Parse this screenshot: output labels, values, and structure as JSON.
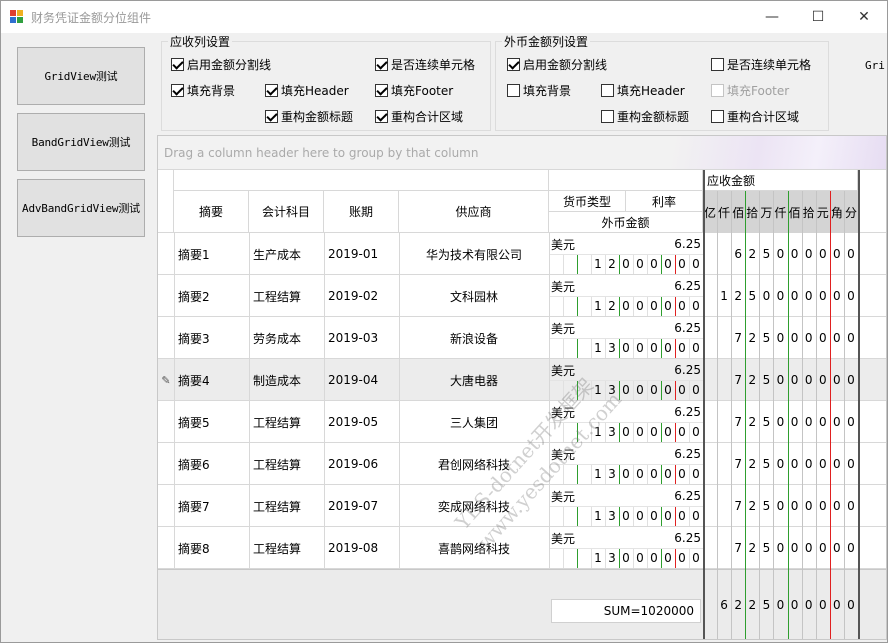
{
  "window": {
    "title": "财务凭证金额分位组件",
    "minimize": "—",
    "maximize": "☐",
    "close": "✕"
  },
  "sidebar": {
    "buttons": [
      "GridView测试",
      "BandGridView测试",
      "AdvBandGridView测试"
    ]
  },
  "group_receivable": {
    "title": "应收列设置",
    "options": [
      {
        "label": "启用金额分割线",
        "checked": true,
        "enabled": true
      },
      {
        "label": "是否连续单元格",
        "checked": true,
        "enabled": true
      },
      {
        "label": "填充背景",
        "checked": true,
        "enabled": true
      },
      {
        "label": "填充Header",
        "checked": true,
        "enabled": true
      },
      {
        "label": "填充Footer",
        "checked": true,
        "enabled": true
      },
      {
        "label": "重构金额标题",
        "checked": true,
        "enabled": true
      },
      {
        "label": "重构合计区域",
        "checked": true,
        "enabled": true
      }
    ]
  },
  "group_foreign": {
    "title": "外币金额列设置",
    "options": [
      {
        "label": "启用金额分割线",
        "checked": true,
        "enabled": true
      },
      {
        "label": "是否连续单元格",
        "checked": false,
        "enabled": true
      },
      {
        "label": "填充背景",
        "checked": false,
        "enabled": true
      },
      {
        "label": "填充Header",
        "checked": false,
        "enabled": true
      },
      {
        "label": "填充Footer",
        "checked": false,
        "enabled": false
      },
      {
        "label": "重构金额标题",
        "checked": false,
        "enabled": true
      },
      {
        "label": "重构合计区域",
        "checked": false,
        "enabled": true
      }
    ]
  },
  "cut_label": "Gri",
  "grid": {
    "group_panel_text": "Drag a column header here to group by that column",
    "headers": {
      "summary": "摘要",
      "account": "会计科目",
      "period": "账期",
      "supplier": "供应商",
      "currency_type": "货币类型",
      "rate": "利率",
      "foreign_amount": "外币金额",
      "receivable_amount": "应收金额",
      "digit_units": [
        "亿",
        "仟",
        "佰",
        "拾",
        "万",
        "仟",
        "佰",
        "拾",
        "元",
        "角",
        "分"
      ]
    },
    "rows": [
      {
        "summary": "摘要1",
        "account": "生产成本",
        "period": "2019-01",
        "supplier": "华为技术有限公司",
        "currency": "美元",
        "rate": "6.25",
        "foreign_digits": [
          "",
          "",
          "",
          "1",
          "2",
          "0",
          "0",
          "0",
          "0",
          "0",
          "0"
        ],
        "amount_digits": [
          "",
          "",
          "6",
          "2",
          "5",
          "0",
          "0",
          "0",
          "0",
          "0",
          "0"
        ]
      },
      {
        "summary": "摘要2",
        "account": "工程结算",
        "period": "2019-02",
        "supplier": "文科园林",
        "currency": "美元",
        "rate": "6.25",
        "foreign_digits": [
          "",
          "",
          "",
          "1",
          "2",
          "0",
          "0",
          "0",
          "0",
          "0",
          "0"
        ],
        "amount_digits": [
          "",
          "1",
          "2",
          "5",
          "0",
          "0",
          "0",
          "0",
          "0",
          "0",
          "0"
        ]
      },
      {
        "summary": "摘要3",
        "account": "劳务成本",
        "period": "2019-03",
        "supplier": "新浪设备",
        "currency": "美元",
        "rate": "6.25",
        "foreign_digits": [
          "",
          "",
          "",
          "1",
          "3",
          "0",
          "0",
          "0",
          "0",
          "0",
          "0"
        ],
        "amount_digits": [
          "",
          "",
          "7",
          "2",
          "5",
          "0",
          "0",
          "0",
          "0",
          "0",
          "0"
        ]
      },
      {
        "summary": "摘要4",
        "account": "制造成本",
        "period": "2019-04",
        "supplier": "大唐电器",
        "currency": "美元",
        "rate": "6.25",
        "foreign_digits": [
          "",
          "",
          "",
          "1",
          "3",
          "0",
          "0",
          "0",
          "0",
          "0",
          "0"
        ],
        "amount_digits": [
          "",
          "",
          "7",
          "2",
          "5",
          "0",
          "0",
          "0",
          "0",
          "0",
          "0"
        ],
        "focused": true
      },
      {
        "summary": "摘要5",
        "account": "工程结算",
        "period": "2019-05",
        "supplier": "三人集团",
        "currency": "美元",
        "rate": "6.25",
        "foreign_digits": [
          "",
          "",
          "",
          "1",
          "3",
          "0",
          "0",
          "0",
          "0",
          "0",
          "0"
        ],
        "amount_digits": [
          "",
          "",
          "7",
          "2",
          "5",
          "0",
          "0",
          "0",
          "0",
          "0",
          "0"
        ]
      },
      {
        "summary": "摘要6",
        "account": "工程结算",
        "period": "2019-06",
        "supplier": "君创网络科技",
        "currency": "美元",
        "rate": "6.25",
        "foreign_digits": [
          "",
          "",
          "",
          "1",
          "3",
          "0",
          "0",
          "0",
          "0",
          "0",
          "0"
        ],
        "amount_digits": [
          "",
          "",
          "7",
          "2",
          "5",
          "0",
          "0",
          "0",
          "0",
          "0",
          "0"
        ]
      },
      {
        "summary": "摘要7",
        "account": "工程结算",
        "period": "2019-07",
        "supplier": "奕成网络科技",
        "currency": "美元",
        "rate": "6.25",
        "foreign_digits": [
          "",
          "",
          "",
          "1",
          "3",
          "0",
          "0",
          "0",
          "0",
          "0",
          "0"
        ],
        "amount_digits": [
          "",
          "",
          "7",
          "2",
          "5",
          "0",
          "0",
          "0",
          "0",
          "0",
          "0"
        ]
      },
      {
        "summary": "摘要8",
        "account": "工程结算",
        "period": "2019-08",
        "supplier": "喜鹊网络科技",
        "currency": "美元",
        "rate": "6.25",
        "foreign_digits": [
          "",
          "",
          "",
          "1",
          "3",
          "0",
          "0",
          "0",
          "0",
          "0",
          "0"
        ],
        "amount_digits": [
          "",
          "",
          "7",
          "2",
          "5",
          "0",
          "0",
          "0",
          "0",
          "0",
          "0"
        ]
      }
    ],
    "footer": {
      "sum_text": "SUM=1020000",
      "amount_digits": [
        "",
        "6",
        "2",
        "2",
        "5",
        "0",
        "0",
        "0",
        "0",
        "0",
        "0"
      ]
    },
    "focus_indicator": "✎"
  },
  "watermark": {
    "line1": "YES-dotnet开发框架",
    "line2": "www.yesdotnet.com"
  },
  "colors": {
    "divider_green": "#2e9e2e",
    "divider_red": "#e02020",
    "header_fill": "#d4d4d4",
    "footer_fill": "#ebebeb"
  }
}
